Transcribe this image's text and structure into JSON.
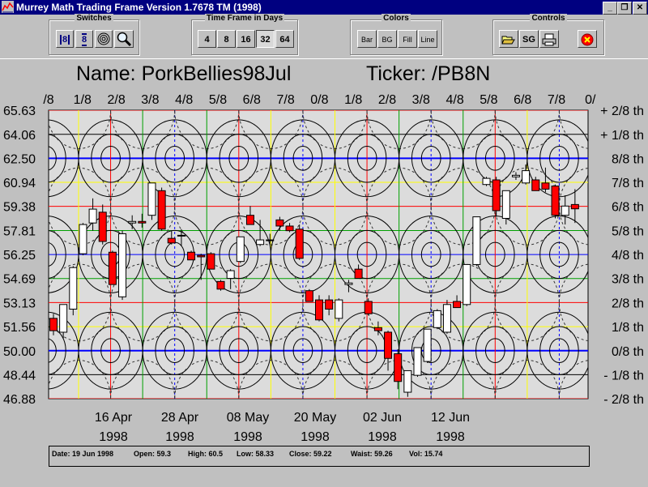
{
  "window": {
    "title": "Murrey Math Trading Frame Version 1.7678  TM (1998)",
    "buttons": [
      "_",
      "❐",
      "✕"
    ]
  },
  "toolbar": {
    "switches": {
      "title": "Switches",
      "buttons": [
        "8",
        "8"
      ]
    },
    "timeframe": {
      "title": "Time Frame in Days",
      "buttons": [
        "4",
        "8",
        "16",
        "32",
        "64"
      ],
      "selected": "32"
    },
    "colors": {
      "title": "Colors",
      "buttons": [
        "Bar",
        "BG",
        "Fill",
        "Line"
      ]
    },
    "controls": {
      "title": "Controls",
      "sg_label": "SG"
    }
  },
  "header": {
    "name": "Name: PorkBellies98Jul",
    "ticker": "Ticker: /PB8N"
  },
  "chart_data": {
    "type": "candlestick",
    "top_labels": [
      "/8",
      "1/8",
      "2/8",
      "3/8",
      "4/8",
      "5/8",
      "6/8",
      "7/8",
      "0/8",
      "1/8",
      "2/8",
      "3/8",
      "4/8",
      "5/8",
      "6/8",
      "7/8",
      "0/"
    ],
    "y_ticks": [
      "65.63",
      "64.06",
      "62.50",
      "60.94",
      "59.38",
      "57.81",
      "56.25",
      "54.69",
      "53.13",
      "51.56",
      "50.00",
      "48.44",
      "46.88"
    ],
    "y_values": [
      65.63,
      64.06,
      62.5,
      60.94,
      59.38,
      57.81,
      56.25,
      54.69,
      53.13,
      51.56,
      50.0,
      48.44,
      46.88
    ],
    "right_labels": [
      "+ 2/8 th",
      "+ 1/8 th",
      "8/8 th",
      "7/8 th",
      "6/8 th",
      "5/8 th",
      "4/8 th",
      "3/8 th",
      "2/8 th",
      "1/8 th",
      "0/8 th",
      "- 1/8 th",
      "- 2/8 th"
    ],
    "x_labels": [
      {
        "date": "16 Apr",
        "year": "1998"
      },
      {
        "date": "28 Apr",
        "year": "1998"
      },
      {
        "date": "08 May",
        "year": "1998"
      },
      {
        "date": "20 May",
        "year": "1998"
      },
      {
        "date": "02 Jun",
        "year": "1998"
      },
      {
        "date": "12 Jun",
        "year": "1998"
      }
    ],
    "ylim": [
      46.88,
      65.63
    ],
    "colors": {
      "up": "#ffffff",
      "down": "#ff0000",
      "bg": "#dcdcdc"
    },
    "candles": [
      {
        "o": 52.1,
        "h": 52.4,
        "l": 51.0,
        "c": 51.3
      },
      {
        "o": 51.2,
        "h": 53.0,
        "l": 50.8,
        "c": 53.0
      },
      {
        "o": 52.7,
        "h": 55.5,
        "l": 52.3,
        "c": 55.4
      },
      {
        "o": 56.3,
        "h": 58.3,
        "l": 56.2,
        "c": 58.2
      },
      {
        "o": 58.3,
        "h": 59.9,
        "l": 57.8,
        "c": 59.2
      },
      {
        "o": 59.0,
        "h": 59.5,
        "l": 56.9,
        "c": 57.1
      },
      {
        "o": 56.4,
        "h": 56.5,
        "l": 54.3,
        "c": 54.3
      },
      {
        "o": 53.5,
        "h": 57.8,
        "l": 53.3,
        "c": 57.6
      },
      {
        "o": 58.3,
        "h": 58.8,
        "l": 57.9,
        "c": 58.4
      },
      {
        "o": 58.4,
        "h": 58.9,
        "l": 58.0,
        "c": 58.3
      },
      {
        "o": 58.8,
        "h": 60.9,
        "l": 58.5,
        "c": 60.9
      },
      {
        "o": 60.4,
        "h": 60.6,
        "l": 57.8,
        "c": 57.9
      },
      {
        "o": 57.3,
        "h": 57.8,
        "l": 56.9,
        "c": 57.0
      },
      {
        "o": 57.5,
        "h": 57.9,
        "l": 56.8,
        "c": 57.5
      },
      {
        "o": 56.4,
        "h": 56.5,
        "l": 55.9,
        "c": 55.9
      },
      {
        "o": 56.2,
        "h": 56.3,
        "l": 54.6,
        "c": 56.1
      },
      {
        "o": 56.3,
        "h": 56.4,
        "l": 55.3,
        "c": 55.3
      },
      {
        "o": 54.5,
        "h": 54.6,
        "l": 53.9,
        "c": 54.0
      },
      {
        "o": 54.7,
        "h": 55.3,
        "l": 54.0,
        "c": 55.2
      },
      {
        "o": 55.8,
        "h": 57.4,
        "l": 55.7,
        "c": 57.4
      },
      {
        "o": 58.8,
        "h": 59.4,
        "l": 58.5,
        "c": 58.2
      },
      {
        "o": 56.9,
        "h": 58.5,
        "l": 56.8,
        "c": 57.2
      },
      {
        "o": 57.2,
        "h": 57.6,
        "l": 56.9,
        "c": 57.2
      },
      {
        "o": 58.5,
        "h": 58.7,
        "l": 57.8,
        "c": 58.1
      },
      {
        "o": 58.1,
        "h": 58.3,
        "l": 57.7,
        "c": 57.8
      },
      {
        "o": 57.9,
        "h": 58.2,
        "l": 55.9,
        "c": 56.0
      },
      {
        "o": 53.9,
        "h": 54.0,
        "l": 53.2,
        "c": 53.2
      },
      {
        "o": 53.3,
        "h": 53.6,
        "l": 51.9,
        "c": 52.0
      },
      {
        "o": 53.3,
        "h": 53.6,
        "l": 52.3,
        "c": 52.7
      },
      {
        "o": 52.1,
        "h": 53.4,
        "l": 51.9,
        "c": 53.3
      },
      {
        "o": 54.3,
        "h": 54.6,
        "l": 53.8,
        "c": 54.4
      },
      {
        "o": 55.3,
        "h": 55.6,
        "l": 54.7,
        "c": 54.7
      },
      {
        "o": 53.2,
        "h": 53.4,
        "l": 52.3,
        "c": 52.4
      },
      {
        "o": 51.5,
        "h": 51.9,
        "l": 51.0,
        "c": 51.3
      },
      {
        "o": 51.2,
        "h": 51.3,
        "l": 48.7,
        "c": 49.5
      },
      {
        "o": 49.8,
        "h": 50.1,
        "l": 47.5,
        "c": 48.0
      },
      {
        "o": 47.3,
        "h": 48.7,
        "l": 47.0,
        "c": 48.7
      },
      {
        "o": 48.4,
        "h": 50.2,
        "l": 48.3,
        "c": 50.2
      },
      {
        "o": 49.3,
        "h": 51.4,
        "l": 49.2,
        "c": 51.4
      },
      {
        "o": 51.5,
        "h": 52.7,
        "l": 51.4,
        "c": 52.6
      },
      {
        "o": 51.2,
        "h": 53.3,
        "l": 51.1,
        "c": 53.0
      },
      {
        "o": 53.2,
        "h": 53.6,
        "l": 52.8,
        "c": 52.8
      },
      {
        "o": 53.0,
        "h": 55.6,
        "l": 52.9,
        "c": 55.6
      },
      {
        "o": 55.6,
        "h": 58.7,
        "l": 55.5,
        "c": 58.7
      },
      {
        "o": 60.8,
        "h": 61.3,
        "l": 60.7,
        "c": 61.2
      },
      {
        "o": 61.1,
        "h": 61.3,
        "l": 58.7,
        "c": 59.1
      },
      {
        "o": 58.6,
        "h": 60.4,
        "l": 58.2,
        "c": 60.4
      },
      {
        "o": 61.3,
        "h": 61.6,
        "l": 61.1,
        "c": 61.4
      },
      {
        "o": 60.9,
        "h": 62.1,
        "l": 60.8,
        "c": 61.7
      },
      {
        "o": 61.1,
        "h": 61.3,
        "l": 60.4,
        "c": 60.4
      },
      {
        "o": 60.9,
        "h": 61.9,
        "l": 60.3,
        "c": 60.5
      },
      {
        "o": 60.7,
        "h": 60.8,
        "l": 58.6,
        "c": 58.8
      },
      {
        "o": 58.8,
        "h": 60.1,
        "l": 58.2,
        "c": 59.4
      },
      {
        "o": 59.5,
        "h": 60.5,
        "l": 58.3,
        "c": 59.22
      }
    ]
  },
  "status": {
    "date": "Date: 19 Jun 1998",
    "open": "Open: 59.3",
    "high": "High: 60.5",
    "low": "Low: 58.33",
    "close": "Close: 59.22",
    "waist": "Waist: 59.26",
    "vol": "Vol: 15.74"
  }
}
